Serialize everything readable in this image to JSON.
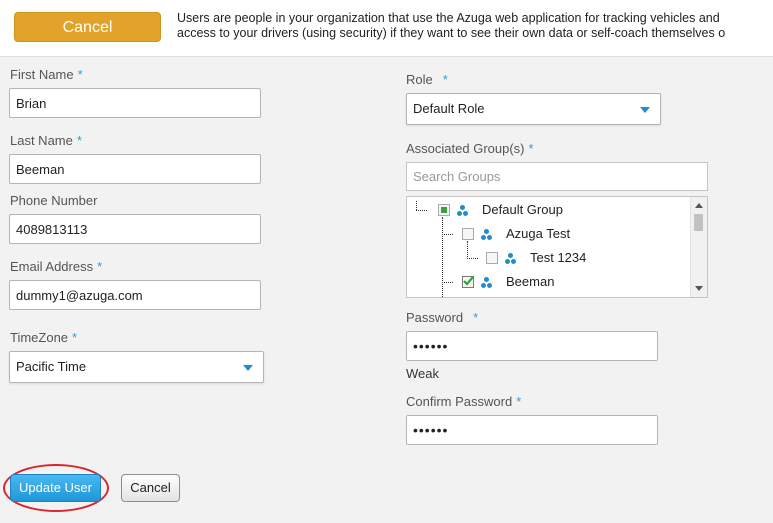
{
  "header": {
    "cancel_label": "Cancel",
    "description_line1": "Users are people in your organization that use the Azuga web application for tracking vehicles and",
    "description_line2": "access to your drivers (using security) if they want to see their own data or self-coach themselves o"
  },
  "required_marker": "*",
  "form": {
    "first_name": {
      "label": "First Name",
      "value": "Brian"
    },
    "last_name": {
      "label": "Last Name",
      "value": "Beeman"
    },
    "phone": {
      "label": "Phone Number",
      "value": "4089813113"
    },
    "email": {
      "label": "Email Address",
      "value": "dummy1@azuga.com"
    },
    "timezone": {
      "label": "TimeZone",
      "value": "Pacific Time"
    },
    "role": {
      "label": "Role",
      "value": "Default Role"
    },
    "groups": {
      "label": "Associated Group(s)",
      "search_placeholder": "Search Groups",
      "items": [
        {
          "label": "Default Group",
          "state": "partial"
        },
        {
          "label": "Azuga Test",
          "state": "unchecked"
        },
        {
          "label": "Test 1234",
          "state": "unchecked"
        },
        {
          "label": "Beeman",
          "state": "checked"
        }
      ]
    },
    "password": {
      "label": "Password",
      "value": "••••••",
      "strength": "Weak"
    },
    "confirm_password": {
      "label": "Confirm Password",
      "value": "••••••"
    }
  },
  "footer": {
    "update_label": "Update User",
    "cancel_label": "Cancel"
  },
  "colors": {
    "accent": "#29a0d6",
    "cancel_top": "#e3a32a",
    "highlight": "#d9262c",
    "check": "#3aa03a"
  }
}
